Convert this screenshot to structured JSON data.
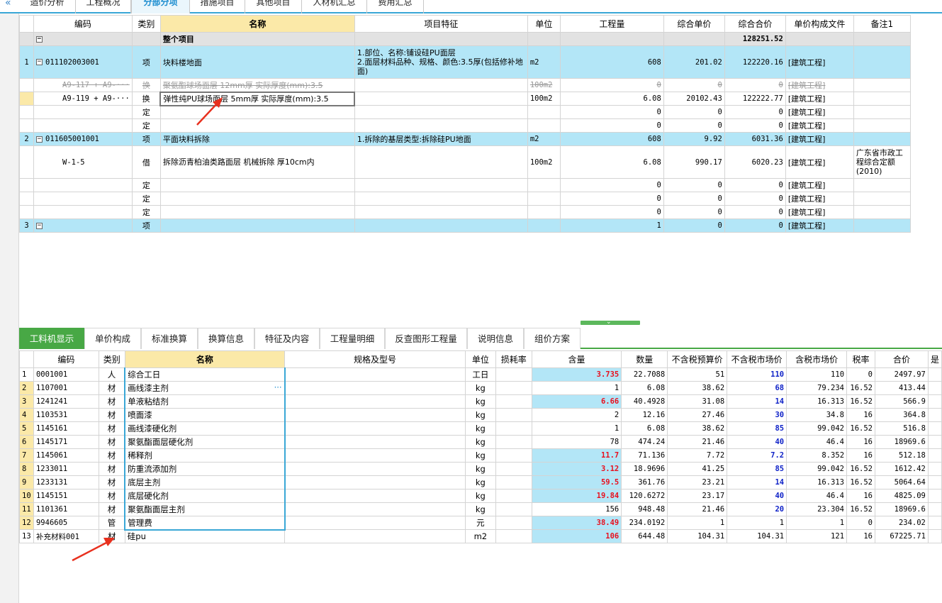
{
  "top_tabs": [
    {
      "label": "造价分析"
    },
    {
      "label": "工程概况"
    },
    {
      "label": "分部分项"
    },
    {
      "label": "措施项目"
    },
    {
      "label": "其他项目"
    },
    {
      "label": "人材机汇总"
    },
    {
      "label": "费用汇总"
    }
  ],
  "top_headers": {
    "code": "编码",
    "type": "类别",
    "name": "名称",
    "feature": "项目特征",
    "unit": "单位",
    "qty": "工程量",
    "uprice": "综合单价",
    "total": "综合合价",
    "file": "单价构成文件",
    "remark": "备注1"
  },
  "whole": {
    "name": "整个项目",
    "total": "128251.52"
  },
  "rows": [
    {
      "no": "1",
      "code": "011102003001",
      "type": "项",
      "name": "块料楼地面",
      "feature": "1.部位、名称:铺设硅PU面层\n2.面层材料品种、规格、颜色:3.5厚(包括修补地面)",
      "unit": "m2",
      "qty": "608",
      "uprice": "201.02",
      "total": "122220.16",
      "file": "[建筑工程]",
      "remark": ""
    },
    {
      "no": "",
      "code": "A9-117 + A9-···",
      "type": "换",
      "name": "聚氨酯球场面层 12mm厚 实际厚度(mm):3.5",
      "feature": "",
      "unit": "100m2",
      "qty": "0",
      "uprice": "0",
      "total": "0",
      "file": "[建筑工程]",
      "remark": ""
    },
    {
      "no": "",
      "code": "A9-119 + A9-···",
      "type": "换",
      "name": "弹性纯PU球场面层 5mm厚  实际厚度(mm):3.5",
      "feature": "",
      "unit": "100m2",
      "qty": "6.08",
      "uprice": "20102.43",
      "total": "122222.77",
      "file": "[建筑工程]",
      "remark": ""
    },
    {
      "no": "",
      "code": "",
      "type": "定",
      "name": "",
      "feature": "",
      "unit": "",
      "qty": "0",
      "uprice": "0",
      "total": "0",
      "file": "[建筑工程]",
      "remark": ""
    },
    {
      "no": "",
      "code": "",
      "type": "定",
      "name": "",
      "feature": "",
      "unit": "",
      "qty": "0",
      "uprice": "0",
      "total": "0",
      "file": "[建筑工程]",
      "remark": ""
    },
    {
      "no": "2",
      "code": "011605001001",
      "type": "项",
      "name": "平面块料拆除",
      "feature": "1.拆除的基层类型:拆除硅PU地面",
      "unit": "m2",
      "qty": "608",
      "uprice": "9.92",
      "total": "6031.36",
      "file": "[建筑工程]",
      "remark": ""
    },
    {
      "no": "",
      "code": "W-1-5",
      "type": "借",
      "name": "拆除沥青柏油类路面层 机械拆除 厚10cm内",
      "feature": "",
      "unit": "100m2",
      "qty": "6.08",
      "uprice": "990.17",
      "total": "6020.23",
      "file": "[建筑工程]",
      "remark": "广东省市政工程综合定额(2010)"
    },
    {
      "no": "",
      "code": "",
      "type": "定",
      "name": "",
      "feature": "",
      "unit": "",
      "qty": "0",
      "uprice": "0",
      "total": "0",
      "file": "[建筑工程]",
      "remark": ""
    },
    {
      "no": "",
      "code": "",
      "type": "定",
      "name": "",
      "feature": "",
      "unit": "",
      "qty": "0",
      "uprice": "0",
      "total": "0",
      "file": "[建筑工程]",
      "remark": ""
    },
    {
      "no": "",
      "code": "",
      "type": "定",
      "name": "",
      "feature": "",
      "unit": "",
      "qty": "0",
      "uprice": "0",
      "total": "0",
      "file": "[建筑工程]",
      "remark": ""
    },
    {
      "no": "3",
      "code": "",
      "type": "项",
      "name": "",
      "feature": "",
      "unit": "",
      "qty": "1",
      "uprice": "0",
      "total": "0",
      "file": "[建筑工程]",
      "remark": ""
    }
  ],
  "bottom_tabs": [
    {
      "label": "工料机显示"
    },
    {
      "label": "单价构成"
    },
    {
      "label": "标准换算"
    },
    {
      "label": "换算信息"
    },
    {
      "label": "特征及内容"
    },
    {
      "label": "工程量明细"
    },
    {
      "label": "反查图形工程量"
    },
    {
      "label": "说明信息"
    },
    {
      "label": "组价方案"
    }
  ],
  "bottom_headers": {
    "code": "编码",
    "type": "类别",
    "name": "名称",
    "spec": "规格及型号",
    "unit": "单位",
    "loss": "损耗率",
    "content": "含量",
    "qty": "数量",
    "budget": "不含税预算价",
    "market": "不含税市场价",
    "taxmarket": "含税市场价",
    "rate": "税率",
    "total": "合价",
    "extra": "是"
  },
  "materials": [
    {
      "no": "1",
      "code": "0001001",
      "type": "人",
      "name": "综合工日",
      "unit": "工日",
      "content": "3.735",
      "qty": "22.7088",
      "budget": "51",
      "market": "110",
      "taxmarket": "110",
      "rate": "0",
      "total": "2497.97"
    },
    {
      "no": "2",
      "code": "1107001",
      "type": "材",
      "name": "画线漆主剂",
      "unit": "kg",
      "content": "1",
      "qty": "6.08",
      "budget": "38.62",
      "market": "68",
      "taxmarket": "79.234",
      "rate": "16.52",
      "total": "413.44"
    },
    {
      "no": "3",
      "code": "1241241",
      "type": "材",
      "name": "单液粘结剂",
      "unit": "kg",
      "content": "6.66",
      "qty": "40.4928",
      "budget": "31.08",
      "market": "14",
      "taxmarket": "16.313",
      "rate": "16.52",
      "total": "566.9"
    },
    {
      "no": "4",
      "code": "1103531",
      "type": "材",
      "name": "喷面漆",
      "unit": "kg",
      "content": "2",
      "qty": "12.16",
      "budget": "27.46",
      "market": "30",
      "taxmarket": "34.8",
      "rate": "16",
      "total": "364.8"
    },
    {
      "no": "5",
      "code": "1145161",
      "type": "材",
      "name": "画线漆硬化剂",
      "unit": "kg",
      "content": "1",
      "qty": "6.08",
      "budget": "38.62",
      "market": "85",
      "taxmarket": "99.042",
      "rate": "16.52",
      "total": "516.8"
    },
    {
      "no": "6",
      "code": "1145171",
      "type": "材",
      "name": "聚氨酯面层硬化剂",
      "unit": "kg",
      "content": "78",
      "qty": "474.24",
      "budget": "21.46",
      "market": "40",
      "taxmarket": "46.4",
      "rate": "16",
      "total": "18969.6"
    },
    {
      "no": "7",
      "code": "1145061",
      "type": "材",
      "name": "稀释剂",
      "unit": "kg",
      "content": "11.7",
      "qty": "71.136",
      "budget": "7.72",
      "market": "7.2",
      "taxmarket": "8.352",
      "rate": "16",
      "total": "512.18"
    },
    {
      "no": "8",
      "code": "1233011",
      "type": "材",
      "name": "防重流添加剂",
      "unit": "kg",
      "content": "3.12",
      "qty": "18.9696",
      "budget": "41.25",
      "market": "85",
      "taxmarket": "99.042",
      "rate": "16.52",
      "total": "1612.42"
    },
    {
      "no": "9",
      "code": "1233131",
      "type": "材",
      "name": "底层主剂",
      "unit": "kg",
      "content": "59.5",
      "qty": "361.76",
      "budget": "23.21",
      "market": "14",
      "taxmarket": "16.313",
      "rate": "16.52",
      "total": "5064.64"
    },
    {
      "no": "10",
      "code": "1145151",
      "type": "材",
      "name": "底层硬化剂",
      "unit": "kg",
      "content": "19.84",
      "qty": "120.6272",
      "budget": "23.17",
      "market": "40",
      "taxmarket": "46.4",
      "rate": "16",
      "total": "4825.09"
    },
    {
      "no": "11",
      "code": "1101361",
      "type": "材",
      "name": "聚氨酯面层主剂",
      "unit": "kg",
      "content": "156",
      "qty": "948.48",
      "budget": "21.46",
      "market": "20",
      "taxmarket": "23.304",
      "rate": "16.52",
      "total": "18969.6"
    },
    {
      "no": "12",
      "code": "9946605",
      "type": "管",
      "name": "管理费",
      "unit": "元",
      "content": "38.49",
      "qty": "234.0192",
      "budget": "1",
      "market": "1",
      "taxmarket": "1",
      "rate": "0",
      "total": "234.02"
    },
    {
      "no": "13",
      "code": "补充材料001",
      "type": "材",
      "name": "硅pu",
      "unit": "m2",
      "content": "106",
      "qty": "644.48",
      "budget": "104.31",
      "market": "104.31",
      "taxmarket": "121",
      "rate": "16",
      "total": "67225.71"
    }
  ],
  "colors": {
    "accent": "#3aa7d6",
    "green_tab": "#48a845",
    "item_row": "#b3e6f7",
    "header_highlight": "#fbe9a8",
    "value_red": "#e8101e",
    "value_blue": "#1023c8",
    "arrow": "#e8301e"
  }
}
